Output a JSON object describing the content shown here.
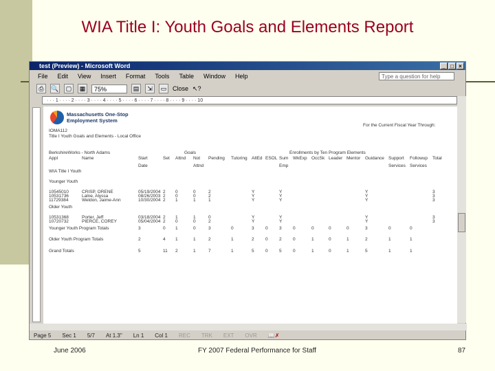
{
  "slide": {
    "title": "WIA Title I: Youth Goals and Elements Report",
    "footer_left": "June 2006",
    "footer_center": "FY 2007 Federal Performance for Staff",
    "footer_right": "87"
  },
  "window": {
    "title": "test (Preview) - Microsoft Word",
    "menu": [
      "File",
      "Edit",
      "View",
      "Insert",
      "Format",
      "Tools",
      "Table",
      "Window",
      "Help"
    ],
    "help_placeholder": "Type a question for help",
    "zoom": "75%",
    "close_label": "Close",
    "ruler": "· · · 1 · · · · 2 · · · · 3 · · · · 4 · · · · 5 · · · · 6 · · · · 7 · · · · 8 · · · · 9 · · · · 10"
  },
  "status": {
    "page": "Page 5",
    "sec": "Sec 1",
    "pages": "5/7",
    "at": "At 1.3\"",
    "ln": "Ln 1",
    "col": "Col 1",
    "modes": [
      "REC",
      "TRK",
      "EXT",
      "OVR"
    ]
  },
  "report": {
    "logo_line1": "Massachusetts One-Stop",
    "logo_line2": "Employment System",
    "period": "For the Current Fiscal Year Through:",
    "form_id": "IOMA112",
    "report_title": "Title I Youth Goals and Elements - Local Office",
    "office": "BerkshireWorks - North Adams",
    "goals_header": "Goals",
    "elements_header": "Enrollments by Ten Program Elements",
    "columns": [
      "Appl",
      "Name",
      "Start",
      "Set",
      "Attnd",
      "Not",
      "Pending",
      "Tutoring",
      "AltEd",
      "ESOL",
      "Sum",
      "WkExp",
      "OccSk",
      "Leader",
      "Mentor",
      "Guidance",
      "Support",
      "Followup",
      "Total"
    ],
    "columns_sub": [
      "",
      "",
      "Date",
      "",
      "",
      "Attnd",
      "",
      "",
      "",
      "",
      "Emp",
      "",
      "",
      "",
      "",
      "",
      "Services",
      "Services",
      ""
    ],
    "section": "WIA Title I Youth",
    "groups": [
      {
        "label": "Younger Youth",
        "rows": [
          [
            "10545010",
            "CRISP, ORENE",
            "05/19/2004",
            "2",
            "0",
            "0",
            "2",
            "",
            "Y",
            "",
            "Y",
            "",
            "",
            "",
            "",
            "Y",
            "",
            "",
            "3"
          ],
          [
            "10531736",
            "Lalne, Alyssa",
            "08/26/2003",
            "2",
            "0",
            "0",
            "2",
            "",
            "Y",
            "",
            "Y",
            "",
            "",
            "",
            "",
            "Y",
            "",
            "",
            "3"
          ],
          [
            "11729384",
            "Weldon, Jaime-Ann",
            "10/30/2004",
            "2",
            "1",
            "1",
            "1",
            "",
            "Y",
            "",
            "Y",
            "",
            "",
            "",
            "",
            "Y",
            "",
            "",
            "3"
          ]
        ]
      },
      {
        "label": "Older Youth",
        "rows": [
          [
            "10531368",
            "Porter, Jeff",
            "03/18/2004",
            "2",
            "1",
            "1",
            "0",
            "",
            "Y",
            "",
            "Y",
            "",
            "",
            "",
            "",
            "Y",
            "",
            "",
            "3"
          ],
          [
            "10720732",
            "PIERCE, COREY",
            "05/04/2004",
            "2",
            "0",
            "0",
            "2",
            "",
            "Y",
            "",
            "Y",
            "",
            "",
            "",
            "",
            "Y",
            "",
            "",
            "3"
          ]
        ]
      }
    ],
    "totals": [
      [
        "Younger Youth Program Totals",
        "",
        "3",
        "0",
        "1",
        "0",
        "3",
        "0",
        "3",
        "0",
        "3",
        "0",
        "0",
        "0",
        "0",
        "3",
        "0",
        "0",
        ""
      ],
      [
        "Older Youth Program Totals",
        "",
        "2",
        "4",
        "1",
        "1",
        "2",
        "1",
        "2",
        "0",
        "2",
        "0",
        "1",
        "0",
        "1",
        "2",
        "1",
        "1",
        ""
      ],
      [
        "Grand Totals",
        "",
        "5",
        "11",
        "2",
        "1",
        "7",
        "1",
        "5",
        "0",
        "5",
        "0",
        "1",
        "0",
        "1",
        "5",
        "1",
        "1",
        ""
      ]
    ]
  }
}
